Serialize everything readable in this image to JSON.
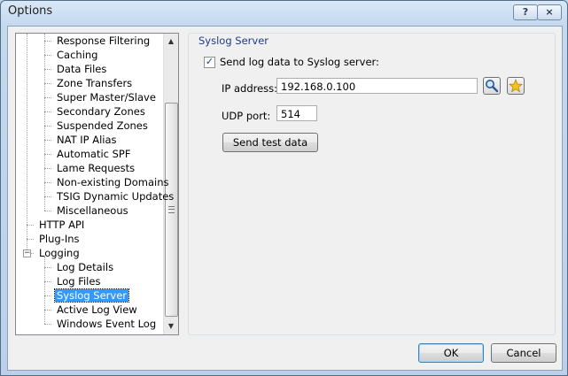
{
  "window": {
    "title": "Options",
    "help_button": "?",
    "close_button": "×"
  },
  "tree": {
    "items": [
      {
        "label": "Response Filtering",
        "level": 2
      },
      {
        "label": "Caching",
        "level": 2
      },
      {
        "label": "Data Files",
        "level": 2
      },
      {
        "label": "Zone Transfers",
        "level": 2
      },
      {
        "label": "Super Master/Slave",
        "level": 2
      },
      {
        "label": "Secondary Zones",
        "level": 2
      },
      {
        "label": "Suspended Zones",
        "level": 2
      },
      {
        "label": "NAT IP Alias",
        "level": 2
      },
      {
        "label": "Automatic SPF",
        "level": 2
      },
      {
        "label": "Lame Requests",
        "level": 2
      },
      {
        "label": "Non-existing Domains",
        "level": 2
      },
      {
        "label": "TSIG Dynamic Updates",
        "level": 2
      },
      {
        "label": "Miscellaneous",
        "level": 2
      },
      {
        "label": "HTTP API",
        "level": 1
      },
      {
        "label": "Plug-Ins",
        "level": 1
      },
      {
        "label": "Logging",
        "level": 1,
        "expander": "−"
      },
      {
        "label": "Log Details",
        "level": 2
      },
      {
        "label": "Log Files",
        "level": 2
      },
      {
        "label": "Syslog Server",
        "level": 2,
        "selected": true
      },
      {
        "label": "Active Log View",
        "level": 2
      },
      {
        "label": "Windows Event Log",
        "level": 2
      }
    ],
    "scroll_up": "▲",
    "scroll_down": "▼"
  },
  "syslog": {
    "group_title": "Syslog Server",
    "send_checkbox_label": "Send log data to Syslog server:",
    "send_checked": true,
    "check_mark": "✓",
    "ip_label": "IP address:",
    "ip_value": "192.168.0.100",
    "lookup_icon": "magnifier-icon",
    "favorites_icon": "star-icon",
    "port_label": "UDP port:",
    "port_value": "514",
    "test_button": "Send test data"
  },
  "footer": {
    "ok": "OK",
    "cancel": "Cancel"
  },
  "colors": {
    "selection": "#3399ff",
    "group_title": "#1f3c88"
  }
}
